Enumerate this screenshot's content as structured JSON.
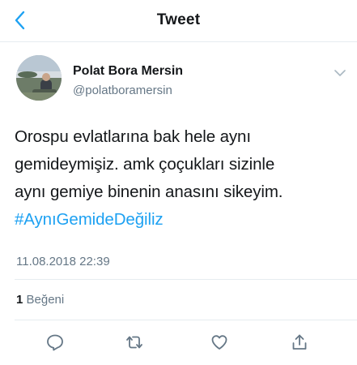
{
  "nav": {
    "title": "Tweet",
    "back_icon": "chevron-left-icon"
  },
  "author": {
    "name": "Polat Bora Mersin",
    "handle": "@polatboramersin"
  },
  "tweet": {
    "lines": [
      "Orospu evlatlarına bak hele aynı",
      "gemideymişiz.  amk çoçukları sizinle",
      "aynı gemiye binenin anasını sikeyim."
    ],
    "hashtag": "#AynıGemideDeğiliz",
    "timestamp": "11.08.2018 22:39"
  },
  "stats": {
    "likes_count": "1",
    "likes_label": "Beğeni"
  },
  "actions": [
    "reply-icon",
    "retweet-icon",
    "like-icon",
    "share-icon"
  ],
  "colors": {
    "accent": "#1da1f2",
    "text": "#14171a",
    "secondary": "#657786",
    "divider": "#e6ecf0"
  }
}
